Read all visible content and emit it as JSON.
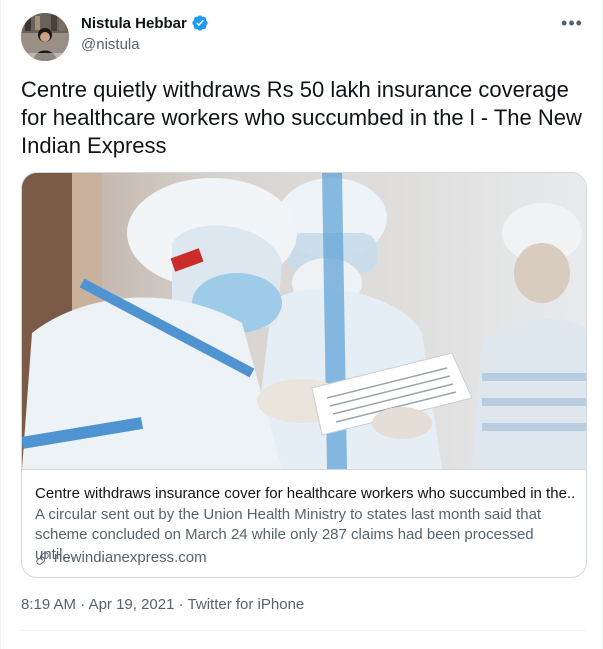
{
  "author": {
    "display_name": "Nistula Hebbar",
    "handle": "@nistula",
    "verified": true,
    "avatar_icon": "avatar-photo"
  },
  "more_icon": "more-horizontal-icon",
  "tweet": {
    "text": "Centre quietly withdraws Rs 50 lakh insurance coverage for healthcare workers who succumbed in the l - The New Indian Express"
  },
  "card": {
    "title": "Centre withdraws insurance cover for healthcare workers who succumbed in the...",
    "description": "A circular sent out by the Union Health Ministry to states last month said that scheme concluded on March 24 while only 287 claims had been processed until...",
    "domain": "newindianexpress.com",
    "image_icon": "healthcare-workers-ppe-photo"
  },
  "meta": {
    "time": "8:19 AM",
    "separator": " · ",
    "date": "Apr 19, 2021",
    "source": "Twitter for iPhone"
  },
  "colors": {
    "text": "#0f1419",
    "secondary": "#536471",
    "verified": "#1d9bf0",
    "border": "#cfd9de"
  }
}
